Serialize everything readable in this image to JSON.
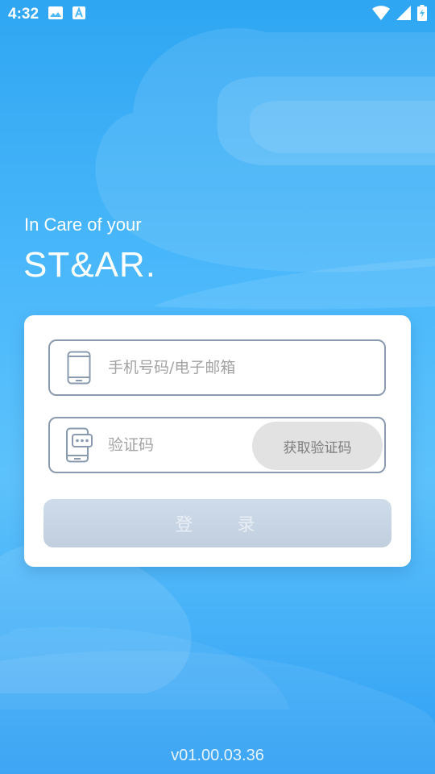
{
  "status_bar": {
    "time": "4:32",
    "icons_left": [
      "image-icon",
      "a-icon"
    ],
    "icons_right": [
      "wifi-icon",
      "signal-icon",
      "battery-charging-icon"
    ]
  },
  "hero": {
    "tagline": "In Care of your",
    "brand": "ST&AR."
  },
  "login_form": {
    "phone_placeholder": "手机号码/电子邮箱",
    "phone_value": "",
    "code_placeholder": "验证码",
    "code_value": "",
    "get_code_label": "获取验证码",
    "submit_label": "登 录"
  },
  "footer": {
    "version": "v01.00.03.36"
  },
  "colors": {
    "background_top": "#2fa6f2",
    "background_mid": "#5dc2fb",
    "field_border": "#8a9bb0",
    "get_code_bg": "#e2e2e2",
    "login_button_bg": "#c8d5e4"
  }
}
